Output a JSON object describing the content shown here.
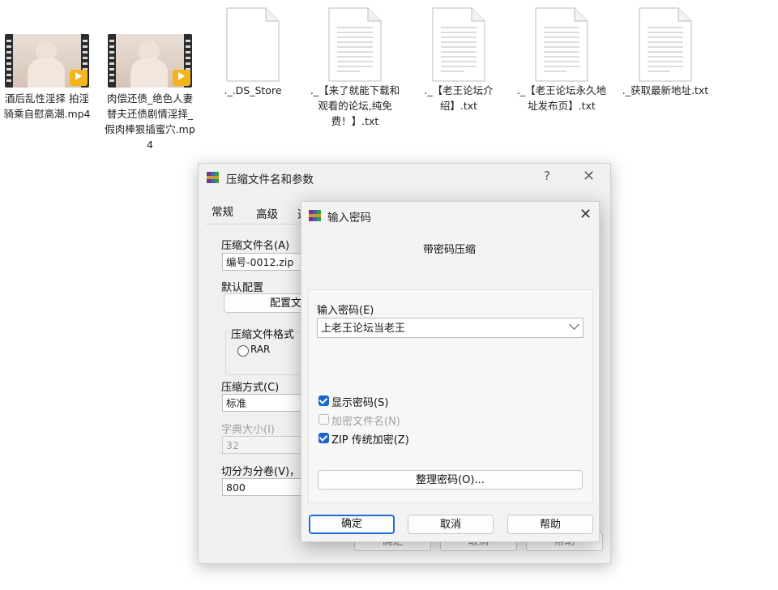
{
  "desktop": {
    "files": [
      {
        "name": "酒后乱性淫择 拍淫骑乘自慰高潮.mp4",
        "type": "video"
      },
      {
        "name": "肉偿还债_绝色人妻替夫还债剧情淫择_假肉棒狠插蜜穴.mp4",
        "type": "video"
      },
      {
        "name": "._.DS_Store",
        "type": "blank"
      },
      {
        "name": "._【来了就能下载和观看的论坛,纯免费！】.txt",
        "type": "text"
      },
      {
        "name": "._【老王论坛介绍】.txt",
        "type": "text"
      },
      {
        "name": "._【老王论坛永久地址发布页】.txt",
        "type": "text"
      },
      {
        "name": "._获取最新地址.txt",
        "type": "text"
      }
    ],
    "video_badge": "Player"
  },
  "main_dialog": {
    "title": "压缩文件名和参数",
    "help": "?",
    "close": "✕",
    "tabs": [
      "常规",
      "高级",
      "选"
    ],
    "archive_name_label": "压缩文件名(A)",
    "archive_name_value": "编号-0012.zip",
    "default_profile_label": "默认配置",
    "profile_button": "配置文件",
    "format_group_label": "压缩文件格式",
    "format_rar": "RAR",
    "method_label": "压缩方式(C)",
    "method_value": "标准",
    "dict_label": "字典大小(I)",
    "dict_value": "32",
    "split_label": "切分为分卷(V)，大",
    "split_value": "800",
    "buttons": [
      "确定",
      "取消",
      "帮助"
    ]
  },
  "password_dialog": {
    "title": "输入密码",
    "close": "✕",
    "heading": "带密码压缩",
    "enter_label": "输入密码(E)",
    "password_value": "上老王论坛当老王",
    "dropdown_icon": "chevron-down",
    "checkboxes": [
      {
        "label": "显示密码(S)",
        "checked": true,
        "enabled": true
      },
      {
        "label": "加密文件名(N)",
        "checked": false,
        "enabled": false
      },
      {
        "label": "ZIP 传统加密(Z)",
        "checked": true,
        "enabled": true
      }
    ],
    "organize_button": "整理密码(O)...",
    "ok": "确定",
    "cancel": "取消",
    "help": "帮助"
  },
  "colors": {
    "accent": "#1f6fd1",
    "checkbox": "#1a66c9",
    "video_badge": "#f3b51b"
  }
}
